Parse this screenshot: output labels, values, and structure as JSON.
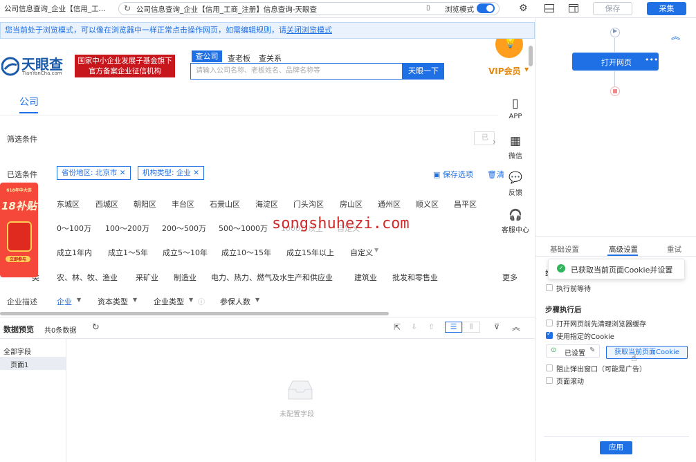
{
  "topbar": {
    "tab_title": "公司信息查询_企业【信用_工...",
    "url": "公司信息查询_企业【信用_工商_注册】信息查询-天眼查",
    "browse_mode_label": "浏览模式",
    "save_label": "保存",
    "collect_label": "采集"
  },
  "notice": {
    "text": "您当前处于浏览模式，可以像在浏览器中一样正常点击操作网页，如需编辑规则，请",
    "link": "关闭浏览模式"
  },
  "site": {
    "logo_cn": "天眼查",
    "logo_en": "TianYanCha.com",
    "banner_line1": "国家中小企业发展子基金旗下",
    "banner_line2": "官方备案企业征信机构",
    "search_tabs": [
      "查公司",
      "查老板",
      "查关系"
    ],
    "search_placeholder": "请输入公司名称、老板姓名、品牌名称等",
    "search_button": "天眼一下",
    "vip": "VIP会员",
    "company_tab": "公司",
    "filter_label": "筛选条件",
    "selected_label": "已选条件",
    "tag_region": "省份地区: 北京市",
    "tag_type": "机构类型: 企业",
    "save_option": "保存选项",
    "clear_option": "清",
    "sidebar": [
      "APP",
      "微信",
      "反馈",
      "客服中心"
    ],
    "districts": [
      "东城区",
      "西城区",
      "朝阳区",
      "丰台区",
      "石景山区",
      "海淀区",
      "门头沟区",
      "房山区",
      "通州区",
      "顺义区",
      "昌平区"
    ],
    "capital": [
      "0～100万",
      "100～200万",
      "200～500万",
      "500～1000万",
      "1000万以上",
      "自定义"
    ],
    "ages": [
      "成立1年内",
      "成立1～5年",
      "成立5～10年",
      "成立10～15年",
      "成立15年以上",
      "自定义"
    ],
    "industries": [
      "农、林、牧、渔业",
      "采矿业",
      "制造业",
      "电力、热力、燃气及水生产和供应业",
      "建筑业",
      "批发和零售业"
    ],
    "more": "更多",
    "row_labels": [
      "类"
    ],
    "bottom_filters": [
      "企业描述",
      "企业",
      "资本类型",
      "企业类型",
      "参保人数"
    ],
    "promo_top": "618年中大促",
    "promo_main": "18补贴",
    "promo_bottom": "立即参与"
  },
  "watermark": "songshuhezi.com",
  "preview": {
    "title": "数据预览",
    "count": "共0条数据",
    "all_fields": "全部字段",
    "page1": "页面1",
    "empty": "未配置字段"
  },
  "rightpanel": {
    "open_page": "打开网页",
    "tabs": [
      "基础设置",
      "高级设置",
      "重试"
    ],
    "toast": "已获取当前页面Cookie并设置",
    "wait_before": "执行前等待",
    "step_section": "步骤执行后",
    "clear_cache": "打开网页前先清理浏览器缓存",
    "use_cookie": "使用指定的Cookie",
    "set_status": "已设置",
    "get_cookie_btn": "获取当前页面Cookie",
    "block_popup": "阻止弹出窗口（可能是广告）",
    "scroll_page": "页面滚动",
    "apply": "应用"
  },
  "colors": {
    "accent": "#1f6fe5",
    "brand_red": "#c8161d",
    "orange": "#ff9d1c",
    "toast_green": "#2fb35b"
  }
}
